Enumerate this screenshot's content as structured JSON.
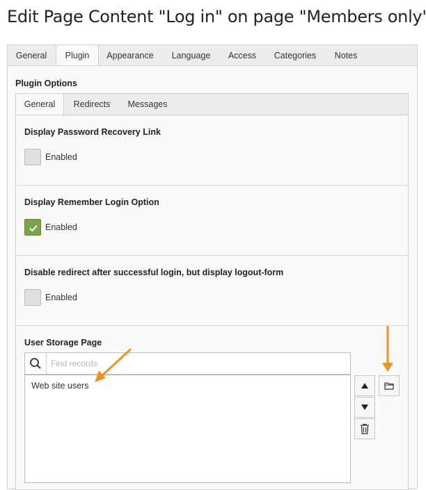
{
  "page": {
    "title": "Edit Page Content \"Log in\" on page \"Members only\""
  },
  "main_tabs": [
    "General",
    "Plugin",
    "Appearance",
    "Language",
    "Access",
    "Categories",
    "Notes"
  ],
  "active_main_tab": "Plugin",
  "plugin_options": {
    "label": "Plugin Options",
    "subtabs": [
      "General",
      "Redirects",
      "Messages"
    ],
    "active_subtab": "General"
  },
  "fields": {
    "password_recovery": {
      "label": "Display Password Recovery Link",
      "checkbox_label": "Enabled",
      "checked": false
    },
    "remember_login": {
      "label": "Display Remember Login Option",
      "checkbox_label": "Enabled",
      "checked": true
    },
    "disable_redirect": {
      "label": "Disable redirect after successful login, but display logout-form",
      "checkbox_label": "Enabled",
      "checked": false
    }
  },
  "user_storage": {
    "label": "User Storage Page",
    "search_placeholder": "Find records",
    "items": [
      "Web site users"
    ]
  },
  "colors": {
    "checkbox_checked": "#79a548",
    "annotation_arrow": "#f0921e"
  },
  "icons": [
    "search-icon",
    "check-icon",
    "move-up-icon",
    "move-down-icon",
    "trash-icon",
    "folder-icon"
  ]
}
